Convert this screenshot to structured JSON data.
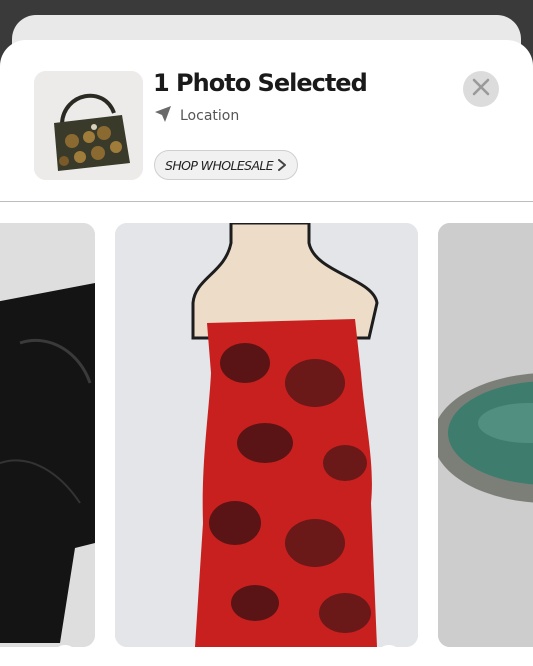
{
  "header": {
    "title": "1 Photo Selected",
    "location_label": "Location",
    "shop_wholesale_label": "SHOP WHOLESALE"
  },
  "icons": {
    "location": "location-arrow-icon",
    "close": "close-icon",
    "wholesale_chevron": "chevron-right-icon",
    "selected": "checkmark-icon"
  },
  "photos": [
    {
      "subject": "black-boot",
      "selected": true
    },
    {
      "subject": "red-floral-dress",
      "selected": true
    },
    {
      "subject": "round-mirror",
      "selected": false
    }
  ],
  "colors": {
    "accent": "#2d7ff0",
    "backdrop": "#3a3a3a",
    "sheet": "#ffffff"
  }
}
